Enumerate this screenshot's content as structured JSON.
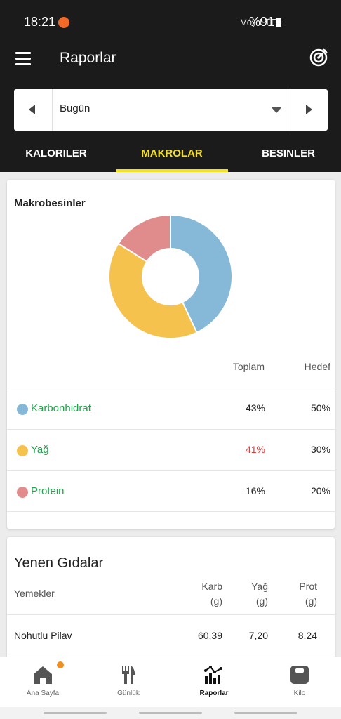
{
  "status": {
    "time": "18:21",
    "signal_text": "Vo) LTE1",
    "battery": "%91"
  },
  "app": {
    "title": "Raporlar"
  },
  "date_picker": {
    "value": "Bugün"
  },
  "tabs": [
    {
      "label": "KALORILER"
    },
    {
      "label": "MAKROLAR"
    },
    {
      "label": "BESINLER"
    }
  ],
  "macros": {
    "title": "Makrobesinler",
    "col_total": "Toplam",
    "col_target": "Hedef",
    "rows": [
      {
        "name": "Karbonhidrat",
        "total": "43%",
        "target": "50%",
        "color": "#86b8d8",
        "total_color": "#222222"
      },
      {
        "name": "Yağ",
        "total": "41%",
        "target": "30%",
        "color": "#f5c24d",
        "total_color": "#e03a3a"
      },
      {
        "name": "Protein",
        "total": "16%",
        "target": "20%",
        "color": "#e08c8c",
        "total_color": "#222222"
      }
    ]
  },
  "chart_data": {
    "type": "pie",
    "categories": [
      "Karbonhidrat",
      "Yağ",
      "Protein"
    ],
    "values": [
      43,
      41,
      16
    ],
    "colors": [
      "#86b8d8",
      "#f5c24d",
      "#e08c8c"
    ]
  },
  "foods": {
    "title": "Yenen Gıdalar",
    "col_meals": "Yemekler",
    "col_carb": [
      "Karb",
      "(g)"
    ],
    "col_fat": [
      "Yağ",
      "(g)"
    ],
    "col_prot": [
      "Prot",
      "(g)"
    ],
    "rows": [
      {
        "name": "Nohutlu Pilav",
        "carb": "60,39",
        "fat": "7,20",
        "prot": "8,24"
      }
    ]
  },
  "nav": [
    {
      "label": "Ana Sayfa",
      "icon": "home-icon"
    },
    {
      "label": "Günlük",
      "icon": "fork-knife-icon"
    },
    {
      "label": "Raporlar",
      "icon": "chart-icon"
    },
    {
      "label": "Kilo",
      "icon": "scale-icon"
    }
  ]
}
